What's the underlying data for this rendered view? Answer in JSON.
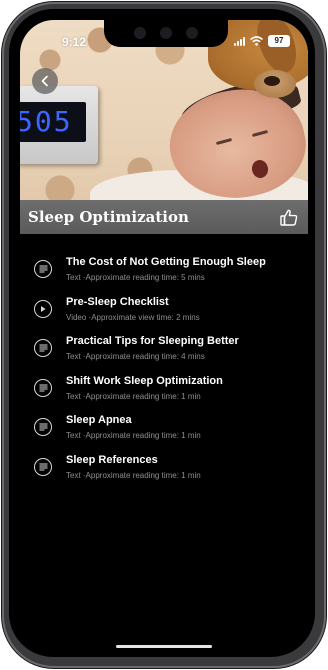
{
  "status_bar": {
    "time": "9:12",
    "battery": "97",
    "signal_icon": "signal-bars-icon",
    "wifi_icon": "wifi-icon"
  },
  "hero": {
    "clock_display": "505",
    "back_icon": "chevron-left-icon"
  },
  "header": {
    "title": "Sleep Optimization",
    "like_icon": "thumbs-up-icon"
  },
  "items": [
    {
      "title": "The Cost of Not Getting Enough Sleep",
      "meta": "Text ·Approximate reading time: 5 mins",
      "icon": "text-document-icon"
    },
    {
      "title": "Pre-Sleep Checklist",
      "meta": "Video ·Approximate view time: 2 mins",
      "icon": "play-icon"
    },
    {
      "title": "Practical Tips for Sleeping Better",
      "meta": "Text ·Approximate reading time: 4 mins",
      "icon": "text-document-icon"
    },
    {
      "title": "Shift Work Sleep Optimization",
      "meta": "Text ·Approximate reading time: 1 min",
      "icon": "text-document-icon"
    },
    {
      "title": "Sleep Apnea",
      "meta": "Text ·Approximate reading time: 1 min",
      "icon": "text-document-icon"
    },
    {
      "title": "Sleep References",
      "meta": "Text ·Approximate reading time: 1 min",
      "icon": "text-document-icon"
    }
  ],
  "colors": {
    "background": "#000000",
    "title_bar": "#5f5f5f",
    "primary_text": "#ffffff",
    "secondary_text": "#8e8e93"
  }
}
